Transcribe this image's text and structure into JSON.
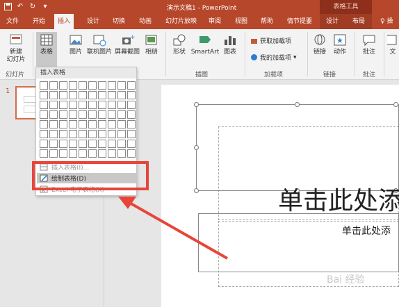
{
  "titlebar": {
    "doc_title": "演示文稿1  -  PowerPoint",
    "tools_label": "表格工具"
  },
  "tabs": [
    "文件",
    "开始",
    "插入",
    "设计",
    "切换",
    "动画",
    "幻灯片放映",
    "审阅",
    "视图",
    "帮助",
    "情节提要",
    "设计",
    "布局",
    "操"
  ],
  "ribbon": {
    "new_slide": "新建\n幻灯片",
    "table": "表格",
    "picture": "图片",
    "online_picture": "联机图片",
    "screenshot": "屏幕截图",
    "album": "相册",
    "shapes": "形状",
    "smartart": "SmartArt",
    "chart": "图表",
    "get_addins": "获取加载项",
    "my_addins": "我的加载项",
    "link": "链接",
    "action": "动作",
    "comment": "批注",
    "text": "文",
    "groups": {
      "slides": "幻灯片",
      "illustrations": "插图",
      "addins": "加载项",
      "links": "链接",
      "comments": "批注"
    }
  },
  "dropdown": {
    "header": "插入表格",
    "items": [
      "插入表格(I)...",
      "绘制表格(D)",
      "Excel 电子表格(X)"
    ]
  },
  "thumbnails": {
    "slide_number": "1"
  },
  "slide": {
    "title_placeholder": "单击此处添",
    "subtitle_placeholder": "单击此处添"
  },
  "watermark": "Bai 经验",
  "colors": {
    "accent": "#b7472a",
    "annotation": "#e8453a"
  }
}
